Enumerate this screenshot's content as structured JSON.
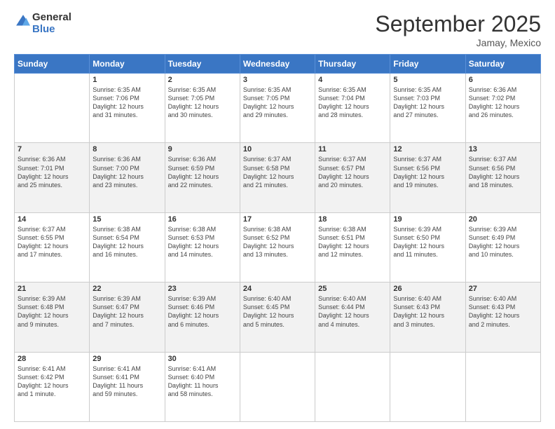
{
  "header": {
    "logo_line1": "General",
    "logo_line2": "Blue",
    "month": "September 2025",
    "location": "Jamay, Mexico"
  },
  "weekdays": [
    "Sunday",
    "Monday",
    "Tuesday",
    "Wednesday",
    "Thursday",
    "Friday",
    "Saturday"
  ],
  "rows": [
    [
      {
        "num": "",
        "info": ""
      },
      {
        "num": "1",
        "info": "Sunrise: 6:35 AM\nSunset: 7:06 PM\nDaylight: 12 hours\nand 31 minutes."
      },
      {
        "num": "2",
        "info": "Sunrise: 6:35 AM\nSunset: 7:05 PM\nDaylight: 12 hours\nand 30 minutes."
      },
      {
        "num": "3",
        "info": "Sunrise: 6:35 AM\nSunset: 7:05 PM\nDaylight: 12 hours\nand 29 minutes."
      },
      {
        "num": "4",
        "info": "Sunrise: 6:35 AM\nSunset: 7:04 PM\nDaylight: 12 hours\nand 28 minutes."
      },
      {
        "num": "5",
        "info": "Sunrise: 6:35 AM\nSunset: 7:03 PM\nDaylight: 12 hours\nand 27 minutes."
      },
      {
        "num": "6",
        "info": "Sunrise: 6:36 AM\nSunset: 7:02 PM\nDaylight: 12 hours\nand 26 minutes."
      }
    ],
    [
      {
        "num": "7",
        "info": "Sunrise: 6:36 AM\nSunset: 7:01 PM\nDaylight: 12 hours\nand 25 minutes."
      },
      {
        "num": "8",
        "info": "Sunrise: 6:36 AM\nSunset: 7:00 PM\nDaylight: 12 hours\nand 23 minutes."
      },
      {
        "num": "9",
        "info": "Sunrise: 6:36 AM\nSunset: 6:59 PM\nDaylight: 12 hours\nand 22 minutes."
      },
      {
        "num": "10",
        "info": "Sunrise: 6:37 AM\nSunset: 6:58 PM\nDaylight: 12 hours\nand 21 minutes."
      },
      {
        "num": "11",
        "info": "Sunrise: 6:37 AM\nSunset: 6:57 PM\nDaylight: 12 hours\nand 20 minutes."
      },
      {
        "num": "12",
        "info": "Sunrise: 6:37 AM\nSunset: 6:56 PM\nDaylight: 12 hours\nand 19 minutes."
      },
      {
        "num": "13",
        "info": "Sunrise: 6:37 AM\nSunset: 6:56 PM\nDaylight: 12 hours\nand 18 minutes."
      }
    ],
    [
      {
        "num": "14",
        "info": "Sunrise: 6:37 AM\nSunset: 6:55 PM\nDaylight: 12 hours\nand 17 minutes."
      },
      {
        "num": "15",
        "info": "Sunrise: 6:38 AM\nSunset: 6:54 PM\nDaylight: 12 hours\nand 16 minutes."
      },
      {
        "num": "16",
        "info": "Sunrise: 6:38 AM\nSunset: 6:53 PM\nDaylight: 12 hours\nand 14 minutes."
      },
      {
        "num": "17",
        "info": "Sunrise: 6:38 AM\nSunset: 6:52 PM\nDaylight: 12 hours\nand 13 minutes."
      },
      {
        "num": "18",
        "info": "Sunrise: 6:38 AM\nSunset: 6:51 PM\nDaylight: 12 hours\nand 12 minutes."
      },
      {
        "num": "19",
        "info": "Sunrise: 6:39 AM\nSunset: 6:50 PM\nDaylight: 12 hours\nand 11 minutes."
      },
      {
        "num": "20",
        "info": "Sunrise: 6:39 AM\nSunset: 6:49 PM\nDaylight: 12 hours\nand 10 minutes."
      }
    ],
    [
      {
        "num": "21",
        "info": "Sunrise: 6:39 AM\nSunset: 6:48 PM\nDaylight: 12 hours\nand 9 minutes."
      },
      {
        "num": "22",
        "info": "Sunrise: 6:39 AM\nSunset: 6:47 PM\nDaylight: 12 hours\nand 7 minutes."
      },
      {
        "num": "23",
        "info": "Sunrise: 6:39 AM\nSunset: 6:46 PM\nDaylight: 12 hours\nand 6 minutes."
      },
      {
        "num": "24",
        "info": "Sunrise: 6:40 AM\nSunset: 6:45 PM\nDaylight: 12 hours\nand 5 minutes."
      },
      {
        "num": "25",
        "info": "Sunrise: 6:40 AM\nSunset: 6:44 PM\nDaylight: 12 hours\nand 4 minutes."
      },
      {
        "num": "26",
        "info": "Sunrise: 6:40 AM\nSunset: 6:43 PM\nDaylight: 12 hours\nand 3 minutes."
      },
      {
        "num": "27",
        "info": "Sunrise: 6:40 AM\nSunset: 6:43 PM\nDaylight: 12 hours\nand 2 minutes."
      }
    ],
    [
      {
        "num": "28",
        "info": "Sunrise: 6:41 AM\nSunset: 6:42 PM\nDaylight: 12 hours\nand 1 minute."
      },
      {
        "num": "29",
        "info": "Sunrise: 6:41 AM\nSunset: 6:41 PM\nDaylight: 11 hours\nand 59 minutes."
      },
      {
        "num": "30",
        "info": "Sunrise: 6:41 AM\nSunset: 6:40 PM\nDaylight: 11 hours\nand 58 minutes."
      },
      {
        "num": "",
        "info": ""
      },
      {
        "num": "",
        "info": ""
      },
      {
        "num": "",
        "info": ""
      },
      {
        "num": "",
        "info": ""
      }
    ]
  ]
}
